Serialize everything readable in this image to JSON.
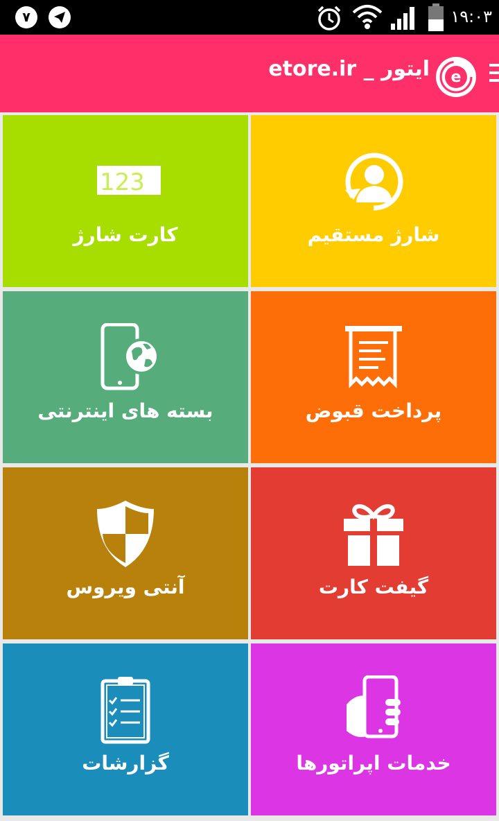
{
  "status_bar": {
    "notification_count": "۷",
    "time": "۱۹:۰۳",
    "icons": [
      "telegram-icon",
      "alarm-icon",
      "wifi-icon",
      "signal-icon",
      "battery-icon"
    ]
  },
  "app_bar": {
    "title": "etore.ir _ ایتور",
    "logo": "etore-logo",
    "menu_icon": "menu-icon"
  },
  "tiles": [
    {
      "label": "شارژ مستقیم",
      "icon": "person-refresh-icon",
      "color": "#ffcc00"
    },
    {
      "label": "کارت شارژ",
      "icon": "charge-card-icon",
      "card_text": "123",
      "color": "#a8dd00"
    },
    {
      "label": "پرداخت قبوض",
      "icon": "receipt-icon",
      "color": "#fd6d08"
    },
    {
      "label": "بسته های اینترنتی",
      "icon": "phone-globe-icon",
      "color": "#56ad7b"
    },
    {
      "label": "گیفت کارت",
      "icon": "gift-icon",
      "color": "#e23c33"
    },
    {
      "label": "آنتی ویروس",
      "icon": "shield-icon",
      "color": "#b7810c"
    },
    {
      "label": "خدمات اپراتورها",
      "icon": "hand-phone-icon",
      "color": "#dc35e3"
    },
    {
      "label": "گزارشات",
      "icon": "clipboard-icon",
      "color": "#1a8dba"
    }
  ],
  "colors": {
    "app_bar": "#ff2f6a",
    "status_bar": "#000000",
    "divider": "#e9e9e9"
  }
}
